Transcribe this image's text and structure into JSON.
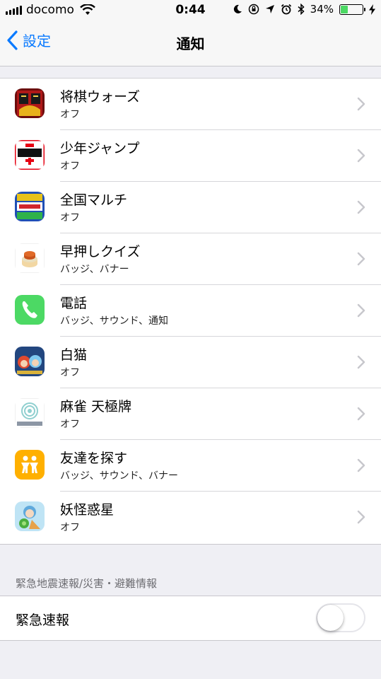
{
  "status": {
    "carrier": "docomo",
    "time": "0:44",
    "battery_percent_label": "34%",
    "battery_level": 0.34,
    "icons": [
      "signal-icon",
      "wifi-icon",
      "moon-icon",
      "rotation-lock-icon",
      "location-icon",
      "alarm-icon",
      "bluetooth-icon",
      "battery-icon",
      "charging-icon"
    ]
  },
  "nav": {
    "back_label": "設定",
    "title": "通知"
  },
  "apps": [
    {
      "name": "将棋ウォーズ",
      "detail": "オフ",
      "icon": "shogi-wars-app-icon",
      "color": "#7a1010"
    },
    {
      "name": "少年ジャンプ",
      "detail": "オフ",
      "icon": "shonen-jump-app-icon",
      "color": "#e60012"
    },
    {
      "name": "全国マルチ",
      "detail": "オフ",
      "icon": "zenkoku-multi-app-icon",
      "color": "#1f4fb5"
    },
    {
      "name": "早押しクイズ",
      "detail": "バッジ、バナー",
      "icon": "hayaoshi-quiz-app-icon",
      "color": "#ffffff"
    },
    {
      "name": "電話",
      "detail": "バッジ、サウンド、通知",
      "icon": "phone-app-icon",
      "color": "#4cd964"
    },
    {
      "name": "白猫",
      "detail": "オフ",
      "icon": "shironeko-app-icon",
      "color": "#2a5aa8"
    },
    {
      "name": "麻雀 天極牌",
      "detail": "オフ",
      "icon": "mahjong-tenkyokuhai-app-icon",
      "color": "#ffffff"
    },
    {
      "name": "友達を探す",
      "detail": "バッジ、サウンド、バナー",
      "icon": "find-friends-app-icon",
      "color": "#ffb000"
    },
    {
      "name": "妖怪惑星",
      "detail": "オフ",
      "icon": "youkai-wakusei-app-icon",
      "color": "#6ab3e0"
    }
  ],
  "emergency": {
    "section_header": "緊急地震速報/災害・避難情報",
    "toggle_label": "緊急速報",
    "toggle_on": false
  }
}
